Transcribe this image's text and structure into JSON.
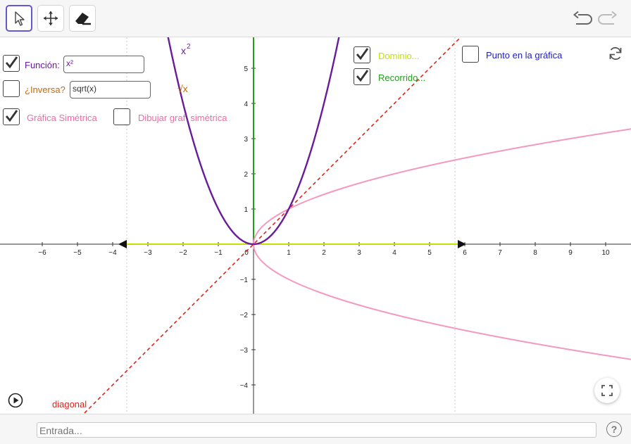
{
  "toolbar": {
    "tools": [
      "move-tool",
      "move-graphics-tool",
      "delete-tool"
    ],
    "active_tool": "move-tool"
  },
  "controls": {
    "funcion_label": "Función:",
    "funcion_value": "x²",
    "inversa_label": "¿Inversa?",
    "inversa_value": "sqrt(x)",
    "simetrica_label": "Gráfica Simétrica",
    "dibujar_label": "Dibujar graf. simétrica",
    "dominio_label": "Dominio...",
    "recorrido_label": "Recorrido...",
    "punto_label": "Punto en la gráfica",
    "diagonal_label": "diagonal",
    "x2_label_base": "x",
    "x2_label_exp": "2",
    "sqrt_label": "√x",
    "checked": {
      "funcion": true,
      "inversa": false,
      "simetrica": true,
      "dibujar": false,
      "dominio": true,
      "recorrido": true,
      "punto": false
    }
  },
  "axes": {
    "x_ticks": [
      "−6",
      "−5",
      "−4",
      "−3",
      "−2",
      "−1",
      "0",
      "1",
      "2",
      "3",
      "4",
      "5",
      "6",
      "7",
      "8",
      "9",
      "10"
    ],
    "y_ticks_pos": [
      "1",
      "2",
      "3",
      "4",
      "5"
    ],
    "y_ticks_neg": [
      "−1",
      "−2",
      "−3",
      "−4"
    ]
  },
  "colors": {
    "purple": "#6a1b9a",
    "pink": "#f49ac1",
    "red": "#e2231a",
    "orange": "#c8690a",
    "yellow": "#c6e000",
    "green": "#22a01c",
    "blue": "#2020c0",
    "accent": "#6557d2"
  },
  "input_bar": {
    "placeholder": "Entrada..."
  }
}
